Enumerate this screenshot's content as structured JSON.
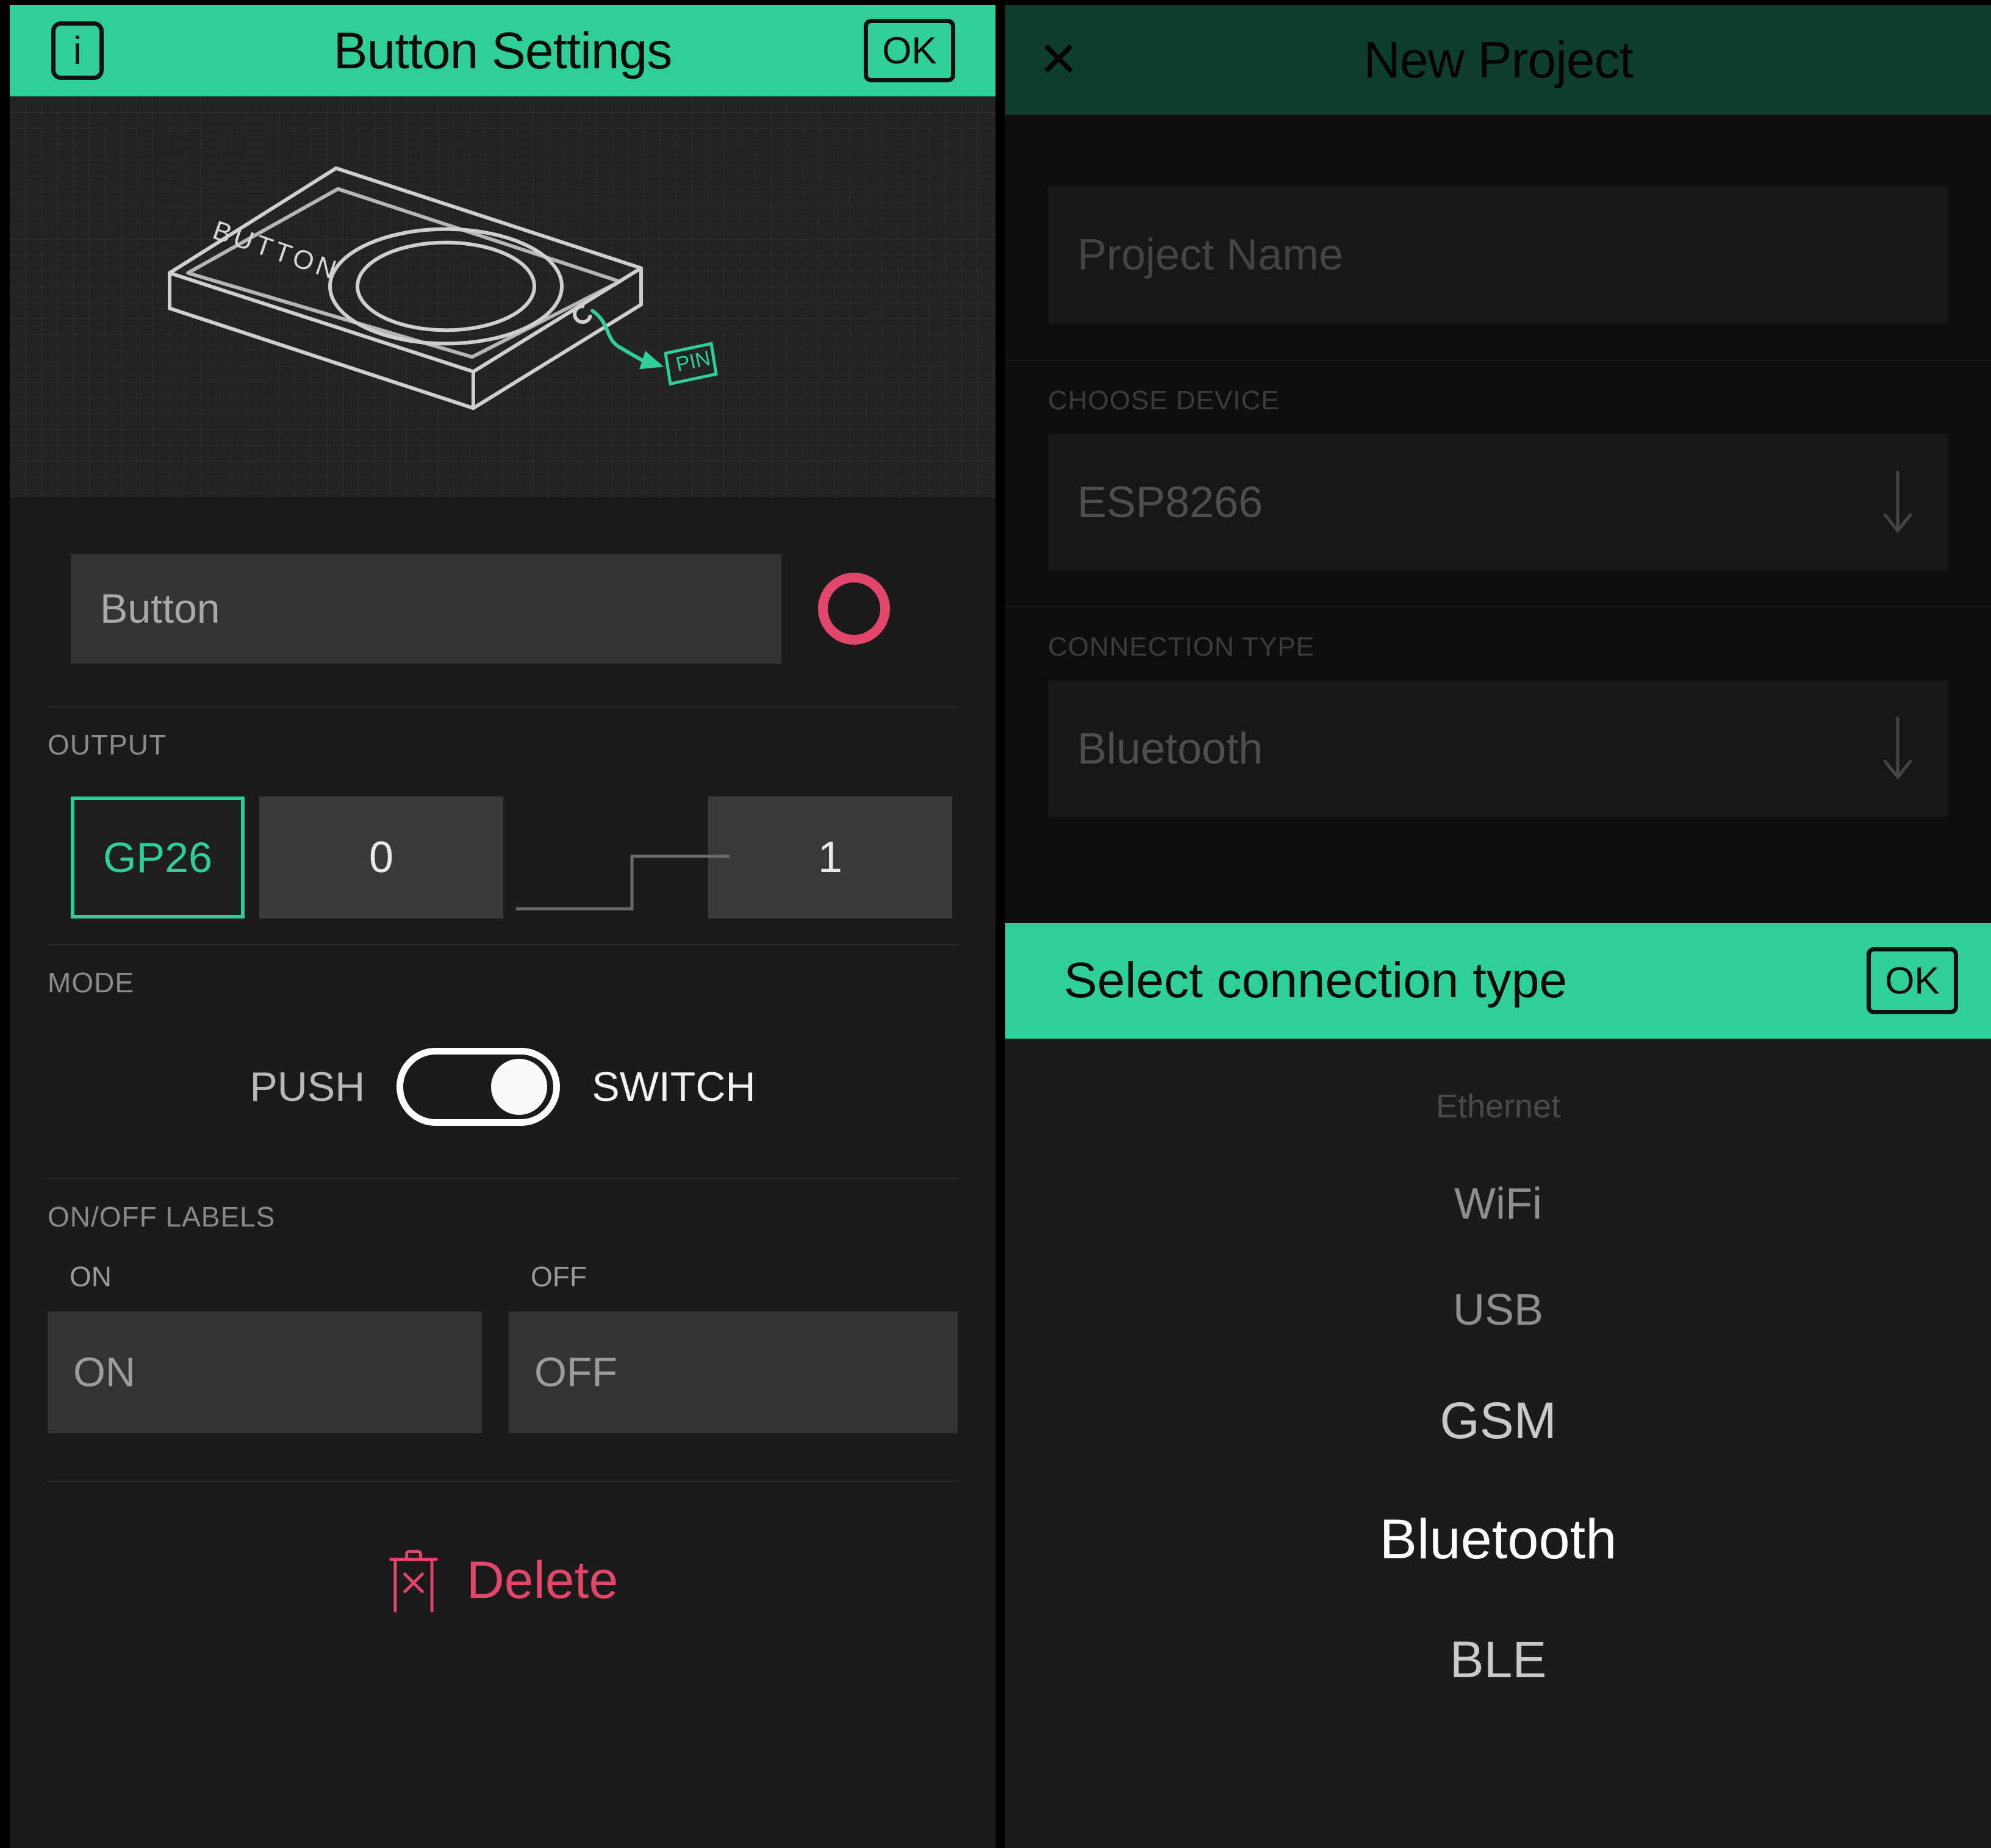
{
  "theme": {
    "accent_green": "#2fcf9a",
    "accent_red": "#e4456b",
    "bg_dark": "#1b1b1b",
    "field_bg": "#333333"
  },
  "left_screen": {
    "topbar": {
      "info_label": "i",
      "title": "Button Settings",
      "ok_label": "OK"
    },
    "preview": {
      "device_label": "BUTTON",
      "pin_tag": "PIN"
    },
    "widget": {
      "name_value": "Button",
      "color": "#e4456b"
    },
    "output": {
      "section_label": "OUTPUT",
      "pin": "GP26",
      "value_off": "0",
      "value_on": "1"
    },
    "mode": {
      "section_label": "MODE",
      "left_label": "PUSH",
      "right_label": "SWITCH",
      "selected": "SWITCH"
    },
    "onoff_labels": {
      "section_label": "ON/OFF LABELS",
      "on_caption": "ON",
      "on_value": "ON",
      "off_caption": "OFF",
      "off_value": "OFF"
    },
    "delete": {
      "label": "Delete"
    }
  },
  "right_screen": {
    "topbar": {
      "close_label": "✕",
      "title": "New Project"
    },
    "project_name": {
      "placeholder": "Project Name",
      "value": "Project Name"
    },
    "choose_device": {
      "section_label": "CHOOSE DEVICE",
      "value": "ESP8266",
      "arrow": "↓"
    },
    "connection_type": {
      "section_label": "CONNECTION TYPE",
      "value": "Bluetooth",
      "arrow": "↓"
    },
    "picker": {
      "title": "Select connection type",
      "ok_label": "OK",
      "options": [
        {
          "label": "Ethernet",
          "state": "far"
        },
        {
          "label": "WiFi",
          "state": "near"
        },
        {
          "label": "USB",
          "state": "near"
        },
        {
          "label": "GSM",
          "state": "close"
        },
        {
          "label": "Bluetooth",
          "state": "selected"
        },
        {
          "label": "BLE",
          "state": "close"
        }
      ],
      "selected": "Bluetooth"
    }
  }
}
